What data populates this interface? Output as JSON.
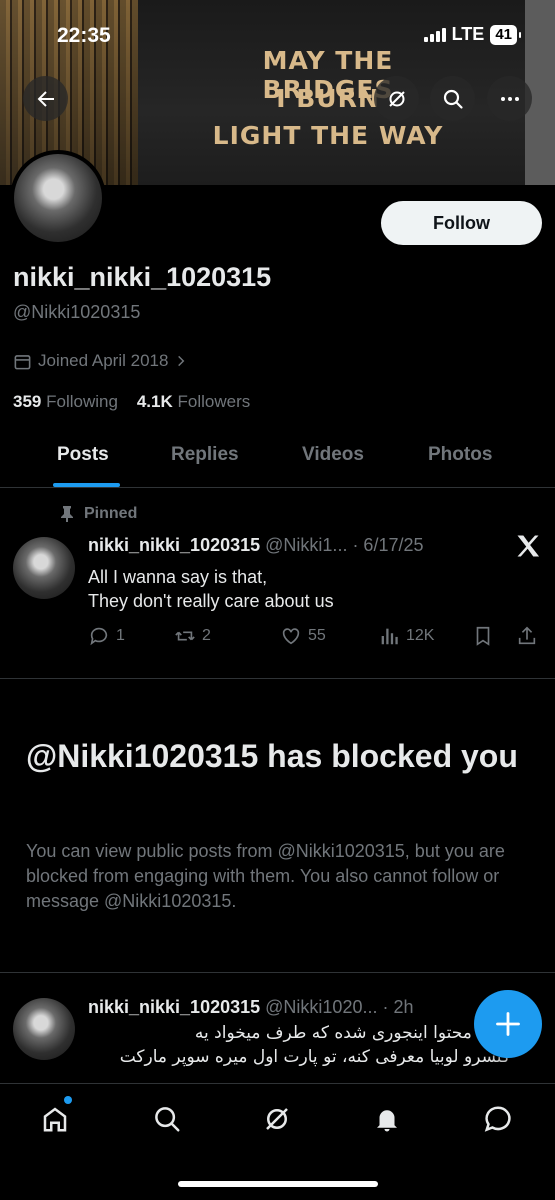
{
  "status_bar": {
    "time": "22:35",
    "network": "LTE",
    "battery": "41"
  },
  "banner": {
    "line1": "MAY THE BRIDGES",
    "line2": "I BURN",
    "line3": "LIGHT THE WAY"
  },
  "profile": {
    "display_name": "nikki_nikki_1020315",
    "handle": "@Nikki1020315",
    "joined": "Joined April 2018",
    "following_count": "359",
    "following_label": "Following",
    "followers_count": "4.1K",
    "followers_label": "Followers",
    "follow_button": "Follow"
  },
  "tabs": [
    "Posts",
    "Replies",
    "Videos",
    "Photos"
  ],
  "pinned_post": {
    "pinned_label": "Pinned",
    "author": "nikki_nikki_1020315",
    "meta": "@Nikki1... · 6/17/25",
    "line1": "All I wanna say is that,",
    "line2": "They don't really care about us",
    "replies": "1",
    "reposts": "2",
    "likes": "55",
    "views": "12K"
  },
  "blocked": {
    "title": "@Nikki1020315 has blocked you",
    "body": "You can view public posts from @Nikki1020315, but you are blocked from engaging with them. You also cannot follow or message @Nikki1020315."
  },
  "second_post": {
    "author": "nikki_nikki_1020315",
    "meta": "@Nikki1020... · 2h",
    "line1": "تولید محتوا اینجوری شده که طرف میخواد یه",
    "line2": "کنسرو لوبیا معرفی کنه، تو پارت اول میره سوپر مارکت"
  },
  "icons": {
    "back": "back-arrow-icon",
    "grok": "grok-icon",
    "search": "search-icon",
    "more": "more-icon",
    "nav": [
      "home-icon",
      "search-icon",
      "grok-icon",
      "notifications-icon",
      "messages-icon"
    ]
  },
  "colors": {
    "accent": "#1d9bf0",
    "secondary_text": "#71767b",
    "primary_text": "#e7e9ea"
  }
}
